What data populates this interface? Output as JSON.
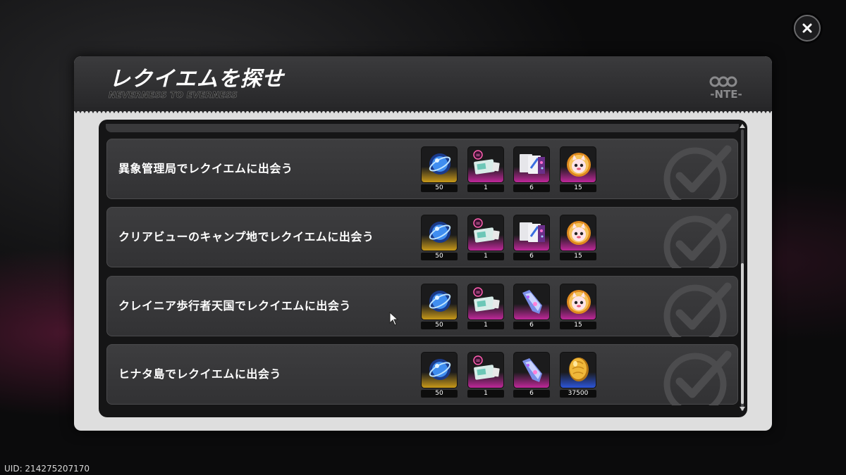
{
  "dialog": {
    "title": "レクイエムを探せ",
    "subtitle": "NEVERNESS TO EVERNESS",
    "logo_text": "NTE",
    "close_icon": "close-icon"
  },
  "tasks": [
    {
      "label": "異象管理局でレクイエムに出会う",
      "completed": true,
      "rewards": [
        {
          "icon": "blue-orb-icon",
          "rarity": "gold",
          "count": "50"
        },
        {
          "icon": "ticket-card-icon",
          "rarity": "pink",
          "count": "1"
        },
        {
          "icon": "blueprint-cards-icon",
          "rarity": "pink",
          "count": "6"
        },
        {
          "icon": "cat-badge-icon",
          "rarity": "pink",
          "count": "15"
        }
      ]
    },
    {
      "label": "クリアビューのキャンプ地でレクイエムに出会う",
      "completed": true,
      "rewards": [
        {
          "icon": "blue-orb-icon",
          "rarity": "gold",
          "count": "50"
        },
        {
          "icon": "ticket-card-icon",
          "rarity": "pink",
          "count": "1"
        },
        {
          "icon": "blueprint-cards-icon",
          "rarity": "pink",
          "count": "6"
        },
        {
          "icon": "cat-badge-icon",
          "rarity": "pink",
          "count": "15"
        }
      ]
    },
    {
      "label": "クレイニア歩行者天国でレクイエムに出会う",
      "completed": true,
      "rewards": [
        {
          "icon": "blue-orb-icon",
          "rarity": "gold",
          "count": "50"
        },
        {
          "icon": "ticket-card-icon",
          "rarity": "pink",
          "count": "1"
        },
        {
          "icon": "crystal-shard-icon",
          "rarity": "pink",
          "count": "6"
        },
        {
          "icon": "cat-badge-icon",
          "rarity": "pink",
          "count": "15"
        }
      ]
    },
    {
      "label": "ヒナタ島でレクイエムに出会う",
      "completed": true,
      "rewards": [
        {
          "icon": "blue-orb-icon",
          "rarity": "gold",
          "count": "50"
        },
        {
          "icon": "ticket-card-icon",
          "rarity": "pink",
          "count": "1"
        },
        {
          "icon": "crystal-shard-icon",
          "rarity": "pink",
          "count": "6"
        },
        {
          "icon": "gold-coin-icon",
          "rarity": "blue",
          "count": "37500"
        }
      ]
    }
  ],
  "footer": {
    "uid": "UID: 214275207170"
  },
  "colors": {
    "rarity_gold": "#c99a1a",
    "rarity_pink": "#c0289a",
    "rarity_blue": "#2c55d8",
    "panel_frame": "#dedede"
  }
}
